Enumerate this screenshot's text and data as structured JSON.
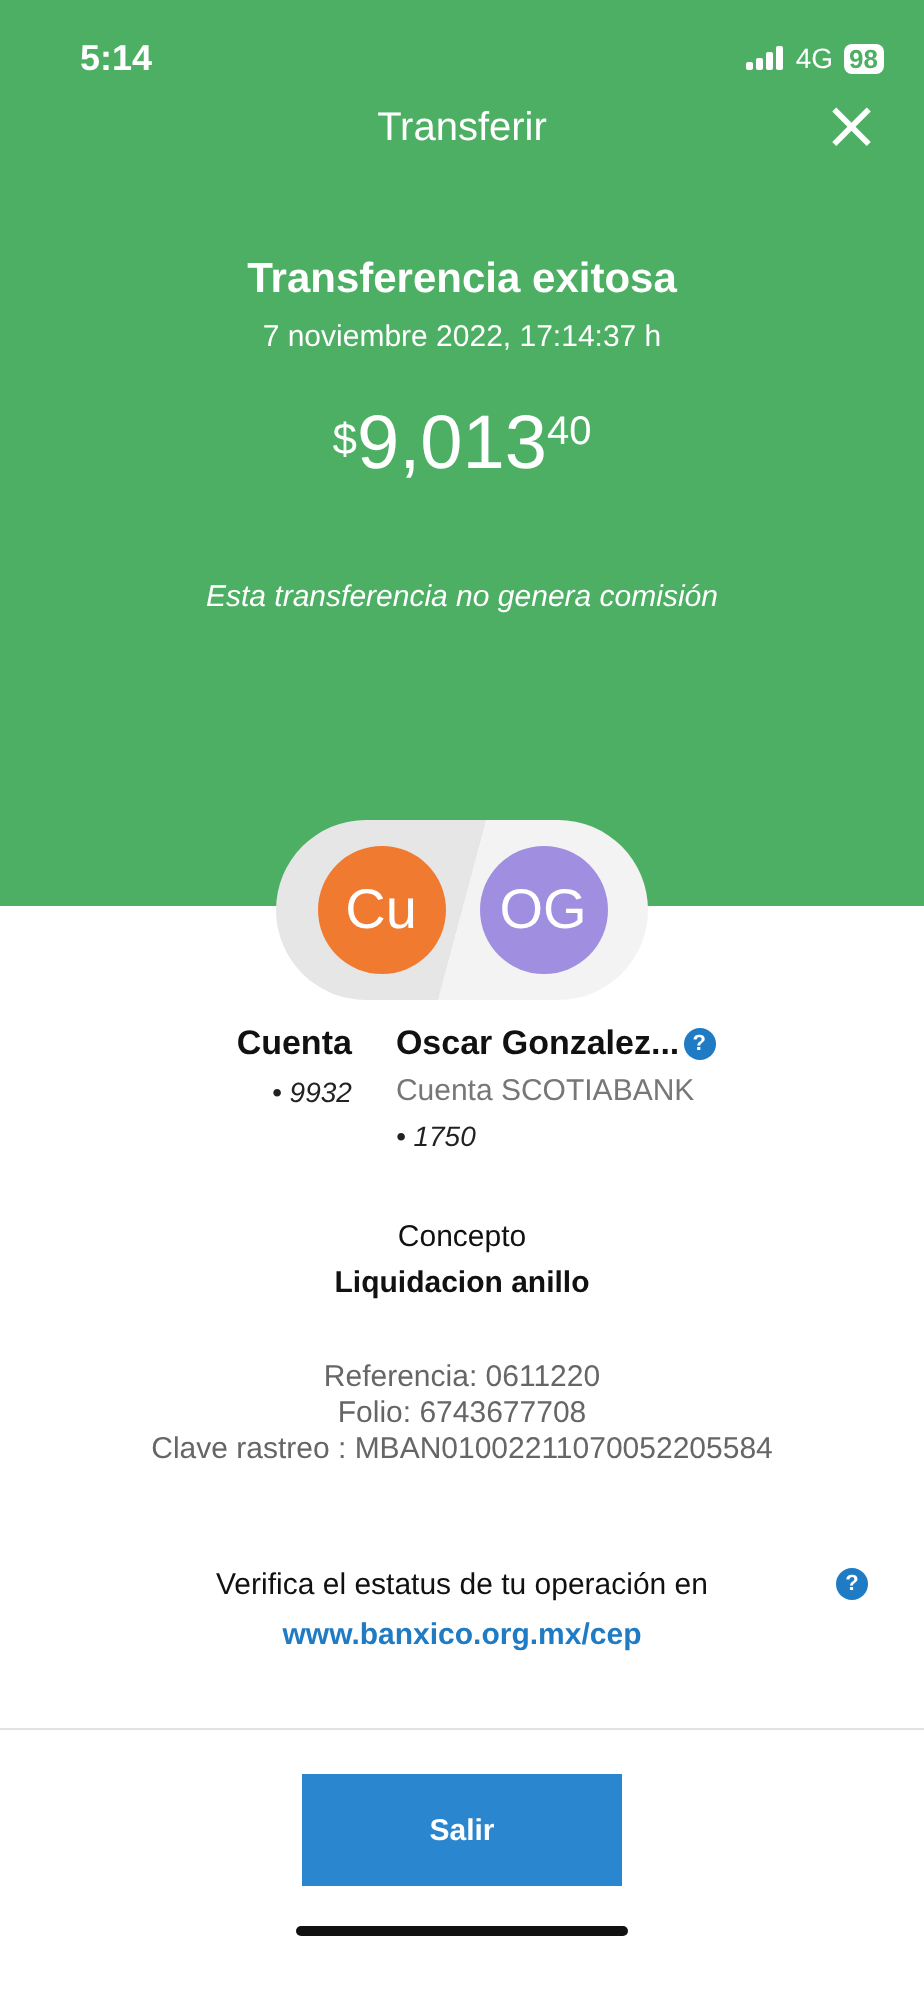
{
  "status_bar": {
    "time": "5:14",
    "network": "4G",
    "battery": "98"
  },
  "header": {
    "title": "Transferir",
    "close": "×"
  },
  "result": {
    "title": "Transferencia exitosa",
    "date": "7 noviembre 2022, 17:14:37 h",
    "currency": "$",
    "amount": "9,013",
    "cents": "40",
    "note": "Esta transferencia no genera comisión"
  },
  "origin": {
    "initials": "Cu",
    "color": "#f07a30",
    "name": "Cuenta",
    "account": "• 9932"
  },
  "destination": {
    "initials": "OG",
    "color": "#a08fe0",
    "name": "Oscar Gonzalez...",
    "help": "?",
    "bank": "Cuenta SCOTIABANK",
    "account": "• 1750"
  },
  "concept": {
    "label": "Concepto",
    "value": "Liquidacion anillo"
  },
  "details": [
    "Referencia: 0611220",
    "Folio: 6743677708",
    "Clave rastreo : MBAN01002211070052205584"
  ],
  "verify": {
    "text": "Verifica el estatus de tu operación en",
    "help": "?",
    "link": "www.banxico.org.mx/cep"
  },
  "button": "Salir"
}
